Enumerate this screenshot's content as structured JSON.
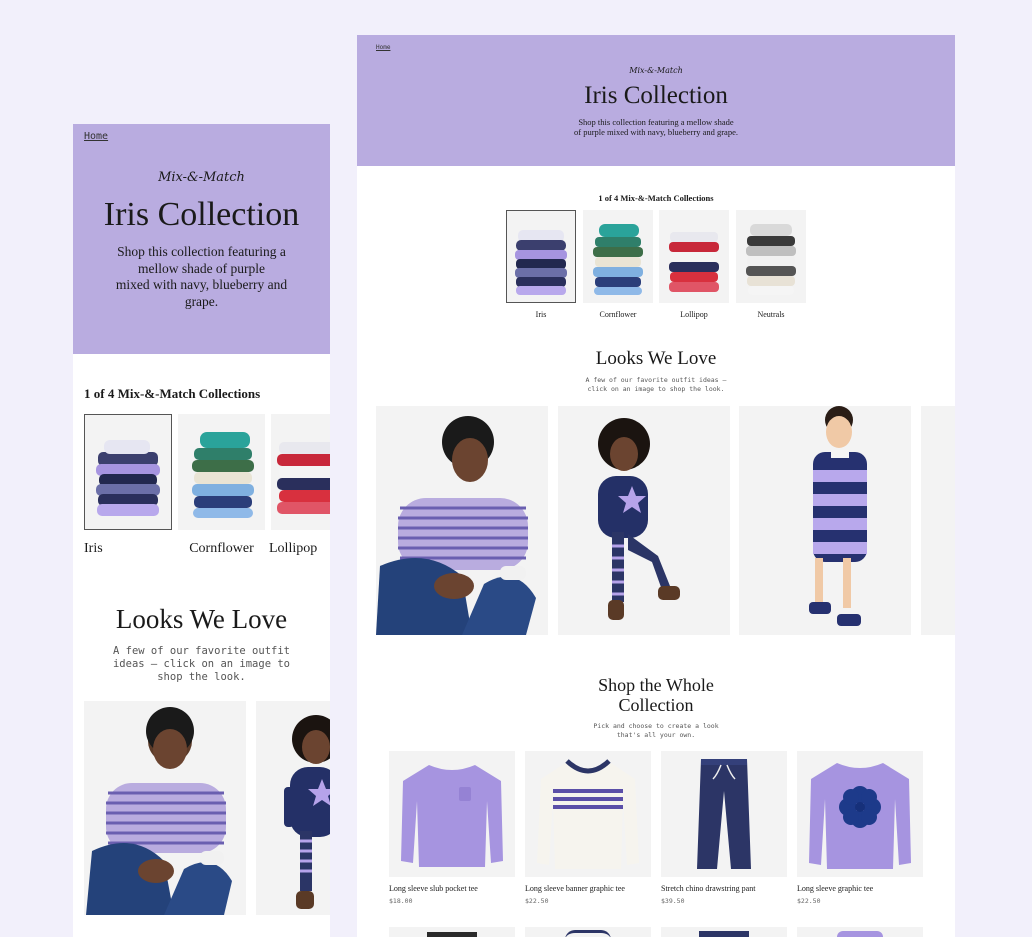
{
  "breadcrumb": {
    "home": "Home"
  },
  "hero": {
    "kicker": "Mix-&-Match",
    "title": "Iris Collection",
    "intro": "Shop this collection featuring a mellow shade of purple mixed with navy, blueberry and grape.",
    "intro_desktop_line1": "Shop this collection featuring a mellow shade",
    "intro_desktop_line2": "of purple mixed with navy, blueberry and grape.",
    "intro_mobile_line1": "Shop this collection featuring a",
    "intro_mobile_line2": "mellow shade of purple",
    "intro_mobile_line3": "mixed with navy, blueberry and",
    "intro_mobile_line4": "grape."
  },
  "collections": {
    "count_label": "1 of 4 Mix-&-Match Collections",
    "items": [
      {
        "label": "Iris"
      },
      {
        "label": "Cornflower"
      },
      {
        "label": "Lollipop"
      },
      {
        "label": "Neutrals"
      }
    ]
  },
  "looks": {
    "title": "Looks We Love",
    "subtitle_line1": "A few of our favorite outfit ideas —",
    "subtitle_line2": "click on an image to shop the look.",
    "mobile_line1": "A few of our favorite outfit",
    "mobile_line2": "ideas — click on an image to",
    "mobile_line3": "shop the look."
  },
  "shop": {
    "title_line1": "Shop the Whole",
    "title_line2": "Collection",
    "subtitle_line1": "Pick and choose to create a look",
    "subtitle_line2": "that's all your own.",
    "products": [
      {
        "name": "Long sleeve slub pocket tee",
        "price": "$18.00"
      },
      {
        "name": "Long sleeve banner graphic tee",
        "price": "$22.50"
      },
      {
        "name": "Stretch chino drawstring pant",
        "price": "$39.50"
      },
      {
        "name": "Long sleeve graphic tee",
        "price": "$22.50"
      }
    ]
  },
  "colors": {
    "background": "#f2f0fb",
    "hero": "#b9ace0",
    "lavender": "#a694e0",
    "navy": "#2c3566"
  }
}
